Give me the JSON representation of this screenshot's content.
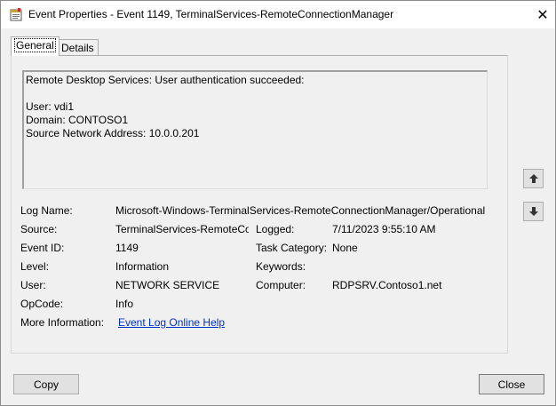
{
  "window": {
    "title": "Event Properties - Event 1149, TerminalServices-RemoteConnectionManager",
    "icon": "event-viewer-icon",
    "close_glyph": "✕"
  },
  "tabs": [
    {
      "label": "General",
      "active": true
    },
    {
      "label": "Details",
      "active": false
    }
  ],
  "description": {
    "lines": [
      "Remote Desktop Services: User authentication succeeded:",
      "",
      "User: vdi1",
      "Domain: CONTOSO1",
      "Source Network Address: 10.0.0.201"
    ]
  },
  "fields": {
    "log_name_label": "Log Name:",
    "log_name_value": "Microsoft-Windows-TerminalServices-RemoteConnectionManager/Operational",
    "source_label": "Source:",
    "source_value": "TerminalServices-RemoteCo",
    "logged_label": "Logged:",
    "logged_value": "7/11/2023 9:55:10 AM",
    "event_id_label": "Event ID:",
    "event_id_value": "1149",
    "task_category_label": "Task Category:",
    "task_category_value": "None",
    "level_label": "Level:",
    "level_value": "Information",
    "keywords_label": "Keywords:",
    "keywords_value": "",
    "user_label": "User:",
    "user_value": "NETWORK SERVICE",
    "computer_label": "Computer:",
    "computer_value": "RDPSRV.Contoso1.net",
    "opcode_label": "OpCode:",
    "opcode_value": "Info",
    "more_info_label": "More Information:",
    "more_info_link": "Event Log Online Help"
  },
  "side_buttons": {
    "up_icon": "arrow-up-icon",
    "down_icon": "arrow-down-icon"
  },
  "buttons": {
    "copy_label": "Copy",
    "close_label": "Close"
  }
}
